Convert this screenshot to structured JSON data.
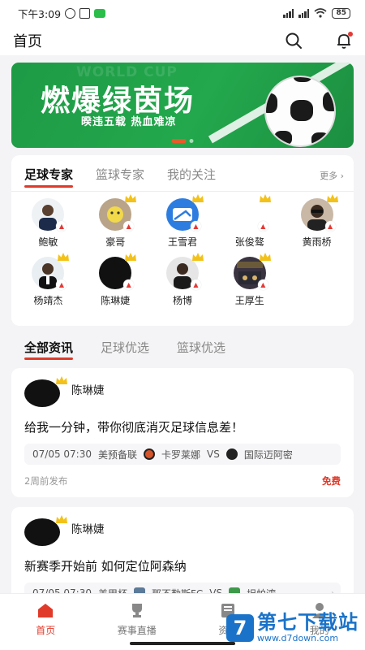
{
  "status_bar": {
    "time": "下午3:09",
    "battery": "85"
  },
  "header": {
    "title": "首页"
  },
  "banner": {
    "watermark_text": "WORLD CUP",
    "headline": "燃爆绿茵场",
    "subtitle": "暌违五载 热血难凉"
  },
  "expert_tabs": [
    "足球专家",
    "篮球专家",
    "我的关注"
  ],
  "expert_more": "更多",
  "experts": [
    {
      "name": "鲍敏"
    },
    {
      "name": "豪哥"
    },
    {
      "name": "王雪君"
    },
    {
      "name": "张俊骜"
    },
    {
      "name": "黄雨桥"
    },
    {
      "name": "杨靖杰"
    },
    {
      "name": "陈琳婕"
    },
    {
      "name": "杨博"
    },
    {
      "name": "王厚生"
    }
  ],
  "news_tabs": [
    "全部资讯",
    "足球优选",
    "篮球优选"
  ],
  "news": [
    {
      "author": "陈琳婕",
      "title": "给我一分钟，带你彻底消灭足球信息差！",
      "match": {
        "datetime": "07/05 07:30",
        "league": "美预备联",
        "home": "卡罗莱娜",
        "vs": "VS",
        "away": "国际迈阿密"
      },
      "time_ago": "2周前发布",
      "price": "免费"
    },
    {
      "author": "陈琳婕",
      "title": "新赛季开始前 如何定位阿森纳",
      "match": {
        "datetime": "07/05 07:30",
        "league": "美甲杯",
        "home": "那不勒斯FC",
        "vs": "VS",
        "away": "坦帕湾"
      }
    }
  ],
  "bottom_nav": [
    "首页",
    "赛事直播",
    "资讯",
    "我的"
  ],
  "watermark": {
    "title": "第七下载站",
    "url": "www.d7down.com"
  },
  "colors": {
    "accent": "#e03a2a",
    "banner_green": "#23a84d"
  }
}
